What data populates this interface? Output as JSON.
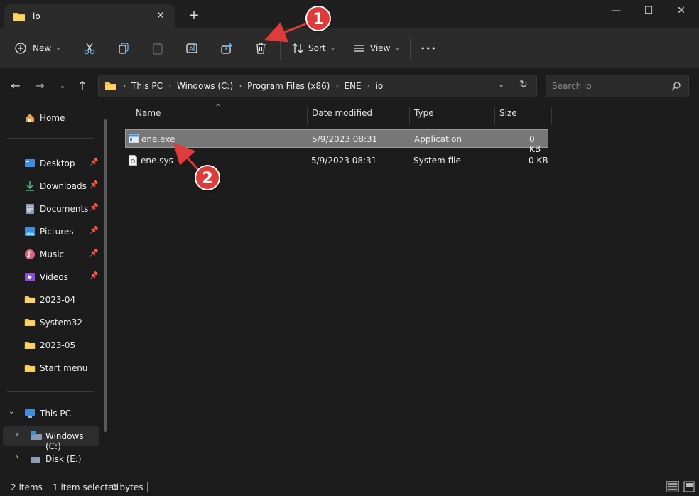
{
  "window": {
    "tab_title": "io",
    "tab_close": "✕",
    "new_tab": "+",
    "minimize": "—",
    "maximize": "☐",
    "close": "✕"
  },
  "toolbar": {
    "new_label": "New",
    "sort_label": "Sort",
    "view_label": "View",
    "more": "•••"
  },
  "address": {
    "crumbs": [
      "This PC",
      "Windows (C:)",
      "Program Files (x86)",
      "ENE",
      "io"
    ],
    "search_placeholder": "Search io"
  },
  "sidebar": {
    "home": "Home",
    "quick": [
      {
        "label": "Desktop",
        "icon": "desktop-icon",
        "pinned": true
      },
      {
        "label": "Downloads",
        "icon": "downloads-icon",
        "pinned": true
      },
      {
        "label": "Documents",
        "icon": "documents-icon",
        "pinned": true
      },
      {
        "label": "Pictures",
        "icon": "pictures-icon",
        "pinned": true
      },
      {
        "label": "Music",
        "icon": "music-icon",
        "pinned": true
      },
      {
        "label": "Videos",
        "icon": "videos-icon",
        "pinned": true
      },
      {
        "label": "2023-04",
        "icon": "folder-icon",
        "pinned": false
      },
      {
        "label": "System32",
        "icon": "folder-icon",
        "pinned": false
      },
      {
        "label": "2023-05",
        "icon": "folder-icon",
        "pinned": false
      },
      {
        "label": "Start menu",
        "icon": "folder-icon",
        "pinned": false
      }
    ],
    "this_pc": "This PC",
    "drives": [
      "Windows (C:)",
      "Disk (E:)"
    ]
  },
  "columns": {
    "name": "Name",
    "date": "Date modified",
    "type": "Type",
    "size": "Size"
  },
  "files": [
    {
      "name": "ene.exe",
      "date": "5/9/2023 08:31",
      "type": "Application",
      "size": "0 KB",
      "selected": true
    },
    {
      "name": "ene.sys",
      "date": "5/9/2023 08:31",
      "type": "System file",
      "size": "0 KB",
      "selected": false
    }
  ],
  "status": {
    "items": "2 items",
    "selected": "1 item selected",
    "bytes": "0 bytes"
  },
  "callouts": {
    "one": "1",
    "two": "2"
  },
  "colors": {
    "accent_callout": "#e03b3b",
    "folder": "#f8c24a"
  }
}
